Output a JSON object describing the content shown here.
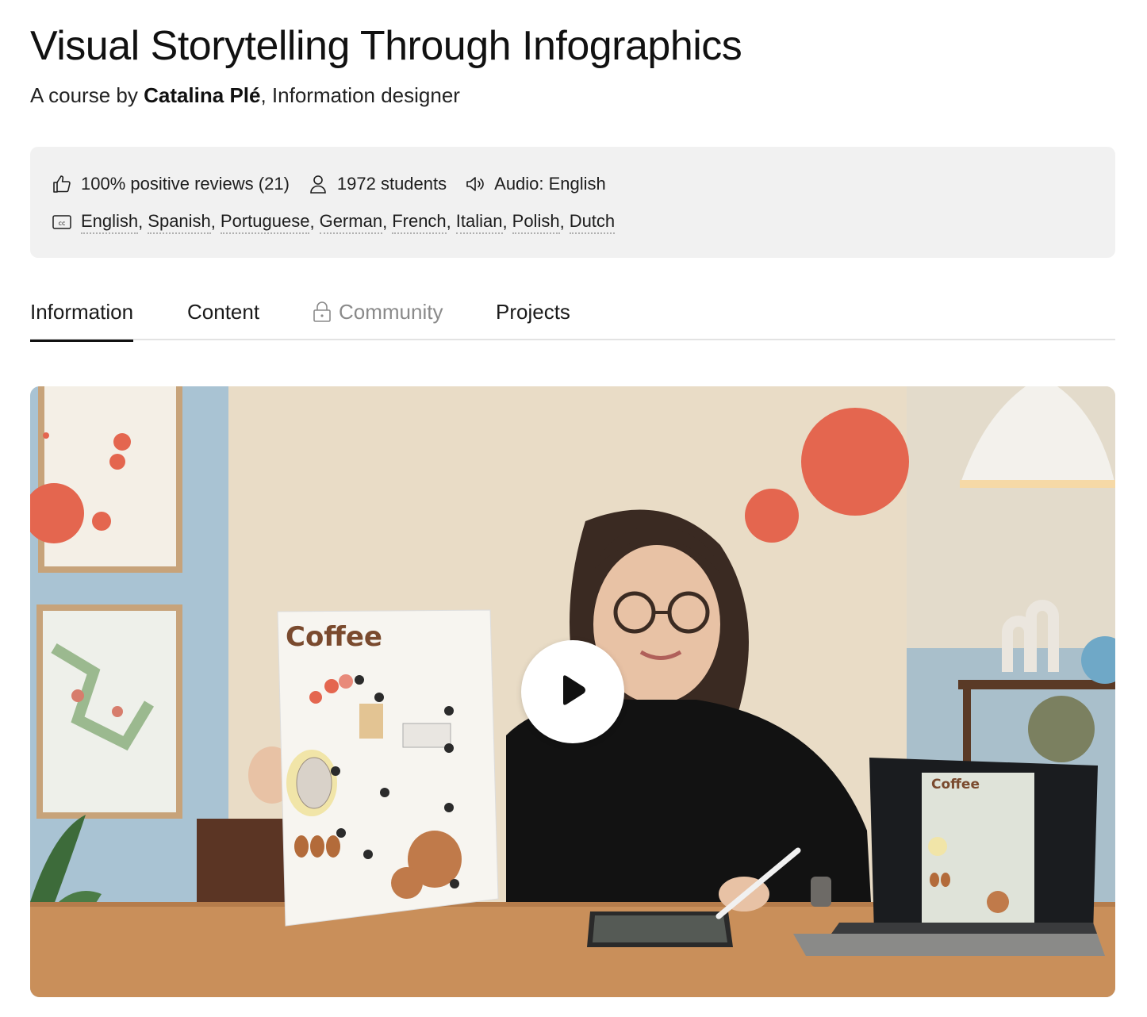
{
  "course": {
    "title": "Visual Storytelling Through Infographics",
    "byline_prefix": "A course by ",
    "author": "Catalina Plé",
    "byline_suffix": ", Information designer"
  },
  "meta": {
    "reviews": "100% positive reviews (21)",
    "students": "1972 students",
    "audio": "Audio: English",
    "subtitles": [
      "English",
      "Spanish",
      "Portuguese",
      "German",
      "French",
      "Italian",
      "Polish",
      "Dutch"
    ]
  },
  "tabs": [
    {
      "label": "Information",
      "active": true,
      "locked": false
    },
    {
      "label": "Content",
      "active": false,
      "locked": false
    },
    {
      "label": "Community",
      "active": false,
      "locked": true
    },
    {
      "label": "Projects",
      "active": false,
      "locked": false
    }
  ],
  "video": {
    "poster_title": "Coffee",
    "laptop_title": "Coffee",
    "colors": {
      "wall": "#e9dcc6",
      "blue_wall": "#a9c3d3",
      "accent_circle": "#e4664f",
      "desk": "#c98f5a",
      "shirt": "#121212"
    }
  },
  "icons": {
    "reviews": "thumbs-up-icon",
    "students": "user-icon",
    "audio": "speaker-icon",
    "subtitles": "closed-captions-icon",
    "community_lock": "lock-icon",
    "play": "play-icon"
  }
}
